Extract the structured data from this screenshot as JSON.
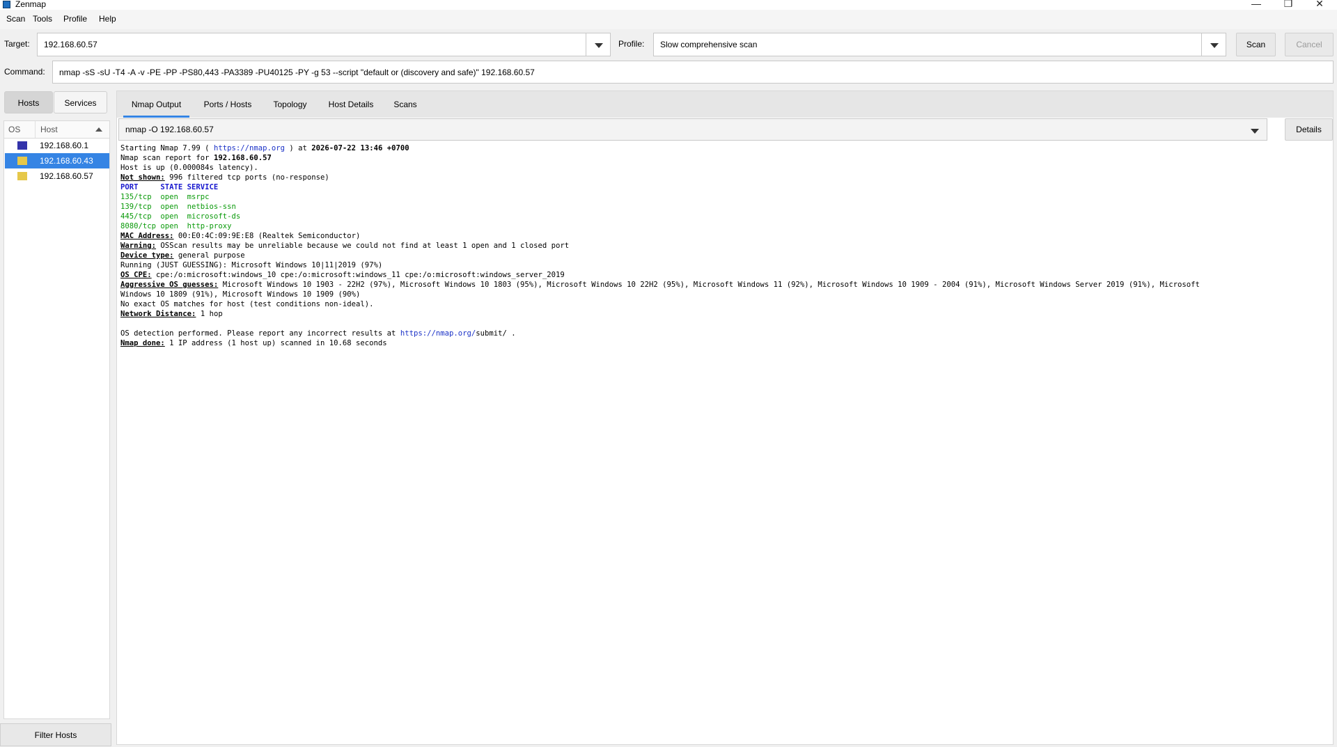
{
  "window": {
    "title": "Zenmap",
    "controls": [
      "—",
      "❐",
      "✕"
    ]
  },
  "menu": [
    "Scan",
    "Tools",
    "Profile",
    "Help"
  ],
  "toolbar": {
    "target_label": "Target:",
    "target_value": "192.168.60.57",
    "profile_label": "Profile:",
    "profile_value": "Slow comprehensive scan",
    "scan_label": "Scan",
    "cancel_label": "Cancel",
    "command_label": "Command:",
    "command_value": "nmap -sS -sU -T4 -A -v -PE -PP -PS80,443 -PA3389 -PU40125 -PY -g 53 --script \"default or (discovery and safe)\" 192.168.60.57"
  },
  "left": {
    "hosts_label": "Hosts",
    "services_label": "Services",
    "col_os": "OS",
    "col_host": "Host",
    "hosts": [
      "192.168.60.1",
      "192.168.60.43",
      "192.168.60.57"
    ],
    "selected_index": 1,
    "filter_label": "Filter Hosts"
  },
  "tabs": [
    "Nmap Output",
    "Ports / Hosts",
    "Topology",
    "Host Details",
    "Scans"
  ],
  "active_tab": 0,
  "output": {
    "scan_select": "nmap -O 192.168.60.57",
    "details_label": "Details",
    "start_pre": "Starting Nmap 7.99 ( ",
    "start_link": "https://nmap.org",
    "start_mid": " ) at ",
    "start_time": "2026-07-22 13:46 +0700",
    "report_pre": "Nmap scan report for ",
    "report_ip": "192.168.60.57",
    "host_up": "Host is up (0.000084s latency).",
    "not_shown_k": "Not shown:",
    "not_shown_v": " 996 filtered tcp ports (no-response)",
    "port_header": "PORT     STATE SERVICE",
    "ports": [
      "135/tcp  open  msrpc",
      "139/tcp  open  netbios-ssn",
      "445/tcp  open  microsoft-ds",
      "8080/tcp open  http-proxy"
    ],
    "mac_k": "MAC Address:",
    "mac_v": " 00:E0:4C:09:9E:E8 (Realtek Semiconductor)",
    "warn_k": "Warning:",
    "warn_v": " OSScan results may be unreliable because we could not find at least 1 open and 1 closed port",
    "device_k": "Device type:",
    "device_v": " general purpose",
    "running": "Running (JUST GUESSING): Microsoft Windows 10|11|2019 (97%)",
    "cpe_k": "OS CPE:",
    "cpe_v": " cpe:/o:microsoft:windows_10 cpe:/o:microsoft:windows_11 cpe:/o:microsoft:windows_server_2019",
    "aggr_k": "Aggressive OS guesses:",
    "aggr_v": " Microsoft Windows 10 1903 - 22H2 (97%), Microsoft Windows 10 1803 (95%), Microsoft Windows 10 22H2 (95%), Microsoft Windows 11 (92%), Microsoft Windows 10 1909 - 2004 (91%), Microsoft Windows Server 2019 (91%), Microsoft",
    "aggr_v2": "Windows 10 1809 (91%), Microsoft Windows 10 1909 (90%)",
    "no_exact": "No exact OS matches for host (test conditions non-ideal).",
    "netdist_k": "Network Distance:",
    "netdist_v": " 1 hop",
    "osdet_pre": "OS detection performed. Please report any incorrect results at ",
    "osdet_link": "https://nmap.org/",
    "osdet_post": "submit/ .",
    "done_k": "Nmap done:",
    "done_v": " 1 IP address (1 host up) scanned in 10.68 seconds"
  },
  "colors": {
    "accent": "#3584e4",
    "link": "#1a31c7",
    "port_green": "#0a9a0a"
  }
}
